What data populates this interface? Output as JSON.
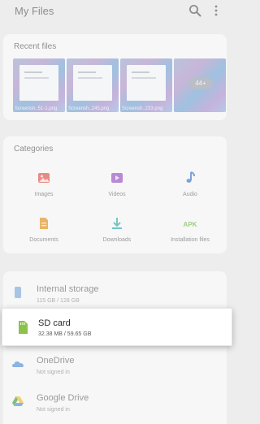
{
  "app": {
    "title": "My Files"
  },
  "header": {
    "search_icon": "search-icon",
    "more_icon": "more-vert-icon"
  },
  "recent": {
    "label": "Recent files",
    "items": [
      {
        "caption": "Screensh..51-1.png"
      },
      {
        "caption": "Screensh..245.png"
      },
      {
        "caption": "Screensh..233.png"
      },
      {
        "caption": ""
      }
    ],
    "more_count": "44+"
  },
  "categories": {
    "label": "Categories",
    "items": [
      {
        "name": "Images",
        "icon": "image-icon",
        "color": "#e88a84"
      },
      {
        "name": "Videos",
        "icon": "video-icon",
        "color": "#b789d6"
      },
      {
        "name": "Audio",
        "icon": "music-note-icon",
        "color": "#7aa3db"
      },
      {
        "name": "Documents",
        "icon": "document-icon",
        "color": "#e8b46a"
      },
      {
        "name": "Downloads",
        "icon": "download-icon",
        "color": "#73c6c4"
      },
      {
        "name": "Installation files",
        "icon": "apk-icon",
        "label": "APK",
        "color": "#9fcf86"
      }
    ]
  },
  "storage": {
    "items": [
      {
        "name": "Internal storage",
        "sub": "115 GB / 128 GB",
        "icon": "phone-icon"
      },
      {
        "name": "SD card",
        "sub": "32.38 MB / 59.65 GB",
        "icon": "sd-card-icon",
        "color": "#8bc34a"
      },
      {
        "name": "OneDrive",
        "sub": "Not signed in",
        "icon": "onedrive-icon"
      },
      {
        "name": "Google Drive",
        "sub": "Not signed in",
        "icon": "google-drive-icon"
      }
    ]
  }
}
